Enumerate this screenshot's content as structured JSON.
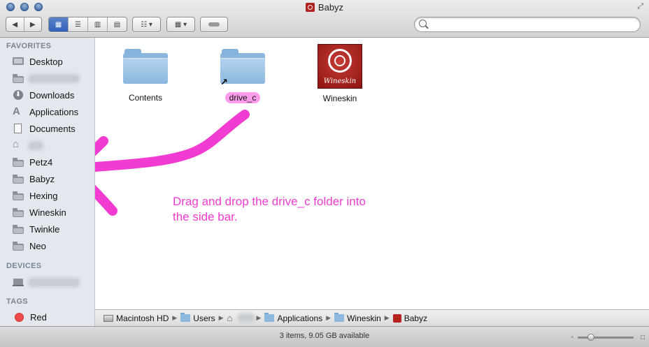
{
  "window": {
    "title": "Babyz"
  },
  "toolbar": {
    "back_glyph": "◀",
    "forward_glyph": "▶",
    "view_glyphs": [
      "▦",
      "☰",
      "▥",
      "▤"
    ],
    "arrange_glyph": "☷ ▾",
    "action_glyph": "▦ ▾",
    "search": {
      "placeholder": ""
    }
  },
  "sidebar": {
    "favorites_header": "FAVORITES",
    "favorites": [
      {
        "label": "Desktop",
        "icon": "desktop-icon"
      },
      {
        "label": "",
        "icon": "folder-icon",
        "blurred": true
      },
      {
        "label": "Downloads",
        "icon": "downloads-icon"
      },
      {
        "label": "Applications",
        "icon": "applications-icon"
      },
      {
        "label": "Documents",
        "icon": "documents-icon"
      },
      {
        "label": "",
        "icon": "home-icon",
        "blurred": true
      },
      {
        "label": "Petz4",
        "icon": "folder-icon"
      },
      {
        "label": "Babyz",
        "icon": "folder-icon"
      },
      {
        "label": "Hexing",
        "icon": "folder-icon"
      },
      {
        "label": "Wineskin",
        "icon": "folder-icon"
      },
      {
        "label": "Twinkle",
        "icon": "folder-icon"
      },
      {
        "label": "Neo",
        "icon": "folder-icon"
      }
    ],
    "devices_header": "DEVICES",
    "devices": [
      {
        "label": "",
        "icon": "laptop-icon",
        "blurred": true
      }
    ],
    "tags_header": "TAGS",
    "tags": [
      {
        "label": "Red",
        "color": "#f04b4b"
      }
    ]
  },
  "files": [
    {
      "label": "Contents",
      "kind": "folder"
    },
    {
      "label": "drive_c",
      "kind": "alias-folder"
    },
    {
      "label": "Wineskin",
      "kind": "app",
      "icon_text": "Wineskin"
    }
  ],
  "annotation": {
    "line1": "Drag and drop the drive_c folder into",
    "line2": "the side bar.",
    "color": "#f23bd1"
  },
  "pathbar": [
    {
      "label": "Macintosh HD",
      "icon": "hd"
    },
    {
      "label": "Users",
      "icon": "folder"
    },
    {
      "label": "",
      "icon": "home",
      "blurred": true
    },
    {
      "label": "Applications",
      "icon": "folder"
    },
    {
      "label": "Wineskin",
      "icon": "folder"
    },
    {
      "label": "Babyz",
      "icon": "app"
    }
  ],
  "status": {
    "text": "3 items, 9.05 GB available",
    "zoom_level": 0.2
  }
}
